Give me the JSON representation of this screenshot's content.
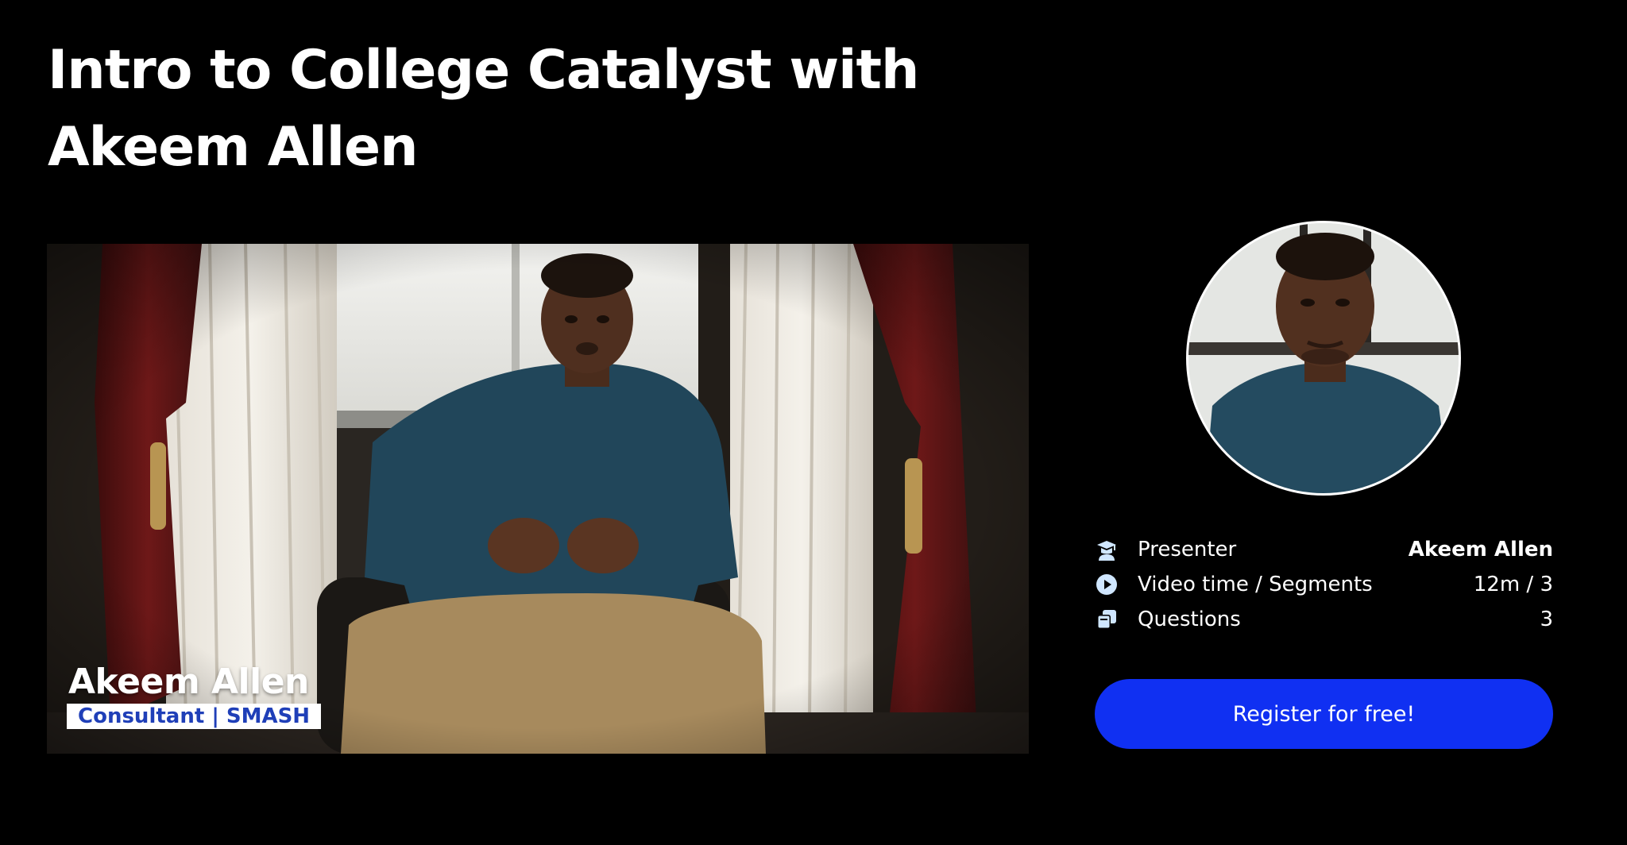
{
  "page": {
    "title": "Intro to College Catalyst with Akeem Allen"
  },
  "video": {
    "overlay_name": "Akeem Allen",
    "overlay_role": "Consultant | SMASH"
  },
  "info": {
    "rows": [
      {
        "icon": "graduation-cap-icon",
        "label": "Presenter",
        "value": "Akeem Allen"
      },
      {
        "icon": "play-circle-icon",
        "label": "Video time / Segments",
        "value": "12m / 3"
      },
      {
        "icon": "question-cards-icon",
        "label": "Questions",
        "value": "3"
      }
    ]
  },
  "register": {
    "label": "Register for free!"
  },
  "colors": {
    "background": "#000000",
    "accent": "#1030f2",
    "icon": "#cfe6ff",
    "overlay_role_text": "#1f3fb8"
  }
}
